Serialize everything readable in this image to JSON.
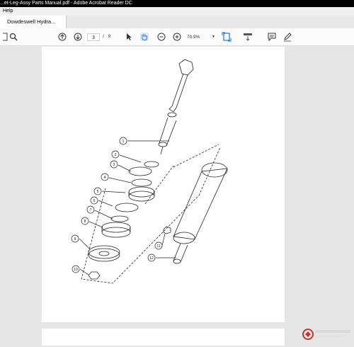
{
  "window": {
    "title": "...et-Leg-Assy Parts Manual.pdf - Adobe Acrobat Reader DC"
  },
  "menu": {
    "items": [
      "Help"
    ]
  },
  "tabs": [
    {
      "label": "Dowdeswell Hydra..."
    }
  ],
  "toolbar": {
    "current_page": "3",
    "page_separator": "/",
    "total_pages": "9",
    "zoom": "70.9%",
    "icons": [
      "search-icon",
      "prev-page-icon",
      "next-page-icon",
      "select-cursor-icon",
      "hand-icon",
      "zoom-out-icon",
      "zoom-in-icon",
      "fit-page-icon",
      "scroll-mode-icon",
      "comment-icon",
      "sign-icon"
    ]
  },
  "diagram": {
    "callouts": [
      "1",
      "2",
      "3",
      "4",
      "5",
      "6",
      "7",
      "8",
      "9",
      "10",
      "11",
      "12"
    ]
  },
  "colors": {
    "titlebar": "#000000",
    "accent": "#1473e6",
    "page": "#ffffff",
    "background": "#e6e6e6"
  }
}
